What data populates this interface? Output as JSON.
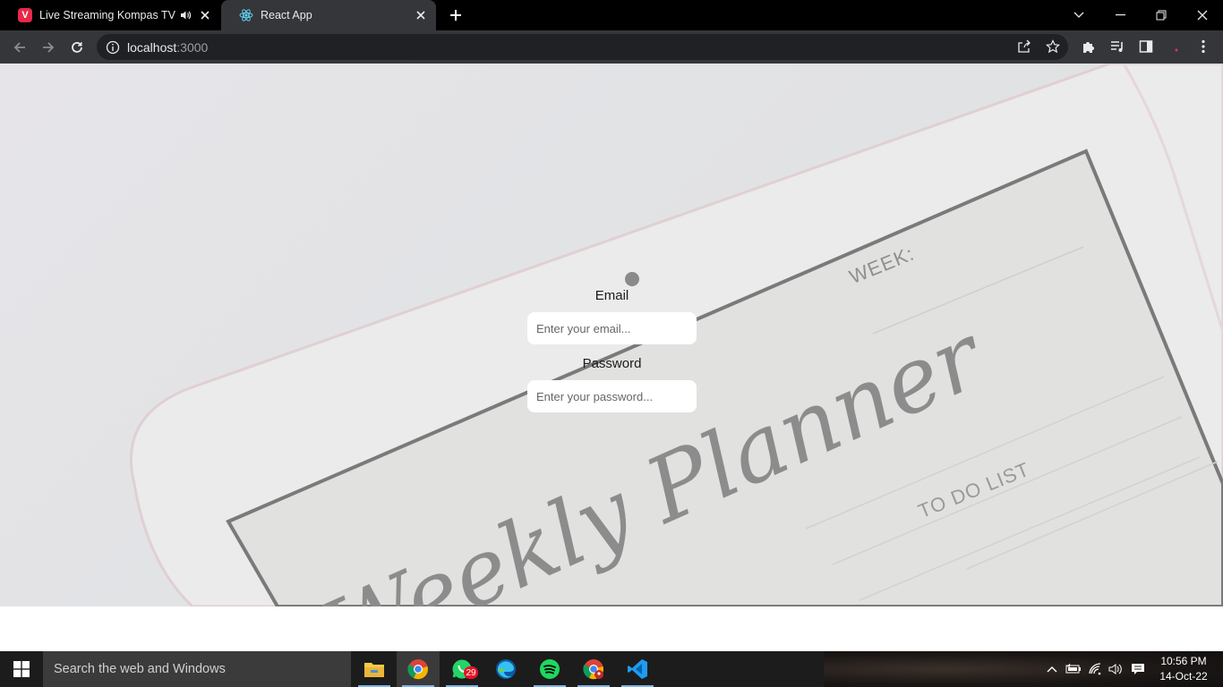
{
  "browser": {
    "tabs": [
      {
        "title": "Live Streaming Kompas TV -",
        "favicon": "vidio-logo-icon",
        "audio": true,
        "active": false
      },
      {
        "title": "React App",
        "favicon": "react-logo-icon",
        "audio": false,
        "active": true
      }
    ],
    "address": {
      "host": "localhost",
      "port": ":3000"
    }
  },
  "page": {
    "background_text": {
      "week": "WEEK:",
      "todo": "TO DO LIST",
      "title": "Weekly Planner"
    },
    "login": {
      "email_label": "Email",
      "email_placeholder": "Enter your email...",
      "email_value": "",
      "password_label": "Password",
      "password_placeholder": "Enter your password...",
      "password_value": ""
    }
  },
  "taskbar": {
    "search_placeholder": "Search the web and Windows",
    "apps": [
      {
        "name": "file-explorer",
        "running": true,
        "active": false
      },
      {
        "name": "chrome",
        "running": true,
        "active": true
      },
      {
        "name": "whatsapp",
        "running": true,
        "active": false,
        "badge": "29"
      },
      {
        "name": "edge",
        "running": false,
        "active": false
      },
      {
        "name": "spotify",
        "running": true,
        "active": false
      },
      {
        "name": "chrome-profile",
        "running": true,
        "active": false
      },
      {
        "name": "vscode",
        "running": true,
        "active": false
      }
    ],
    "clock": {
      "time": "10:56 PM",
      "date": "14-Oct-22"
    }
  },
  "colors": {
    "accent_tab_bg": "#35363a",
    "titlebar": "#000000",
    "react_blue": "#61dafb",
    "badge_red": "#e81123"
  }
}
